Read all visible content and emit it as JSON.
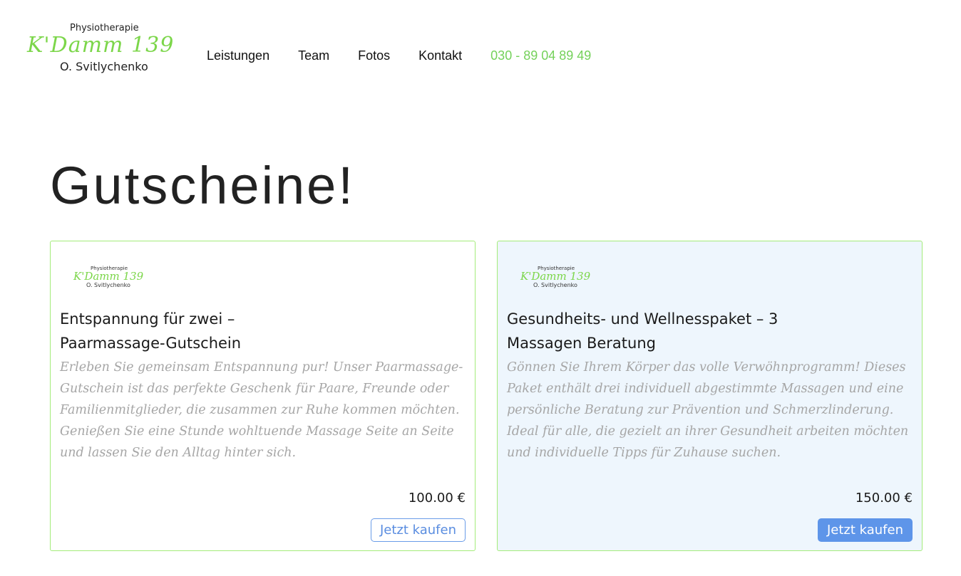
{
  "brand": {
    "top": "Physiotherapie",
    "name": "K'Damm 139",
    "owner": "O. Svitlychenko"
  },
  "nav": {
    "items": [
      "Leistungen",
      "Team",
      "Fotos",
      "Kontakt"
    ],
    "phone": "030 - 89 04 89 49"
  },
  "page": {
    "title": "Gutscheine!"
  },
  "vouchers": [
    {
      "title": "Entspannung für zwei – Paarmassage-Gutschein",
      "description": "Erleben Sie gemeinsam Entspannung pur! Unser Paarmassage-Gutschein ist das perfekte Geschenk für Paare, Freunde oder Familienmitglieder, die zusammen zur Ruhe kommen möchten. Genießen Sie eine Stunde wohltuende Massage Seite an Seite und lassen Sie den Alltag hinter sich.",
      "price": "100.00 €",
      "button": "Jetzt kaufen"
    },
    {
      "title": "Gesundheits- und Wellnesspaket – 3 Massagen Beratung",
      "description": "Gönnen Sie Ihrem Körper das volle Verwöhnprogramm! Dieses Paket enthält drei individuell abgestimmte Massagen und eine persönliche Beratung zur Prävention und Schmerzlinderung. Ideal für alle, die gezielt an ihrer Gesundheit arbeiten möchten und individuelle Tipps für Zuhause suchen.",
      "price": "150.00 €",
      "button": "Jetzt kaufen"
    }
  ],
  "colors": {
    "accent_green": "#7cd64a",
    "phone_green": "#74d15a",
    "button_blue": "#5e95e9",
    "card_border": "#a4ec7a"
  }
}
